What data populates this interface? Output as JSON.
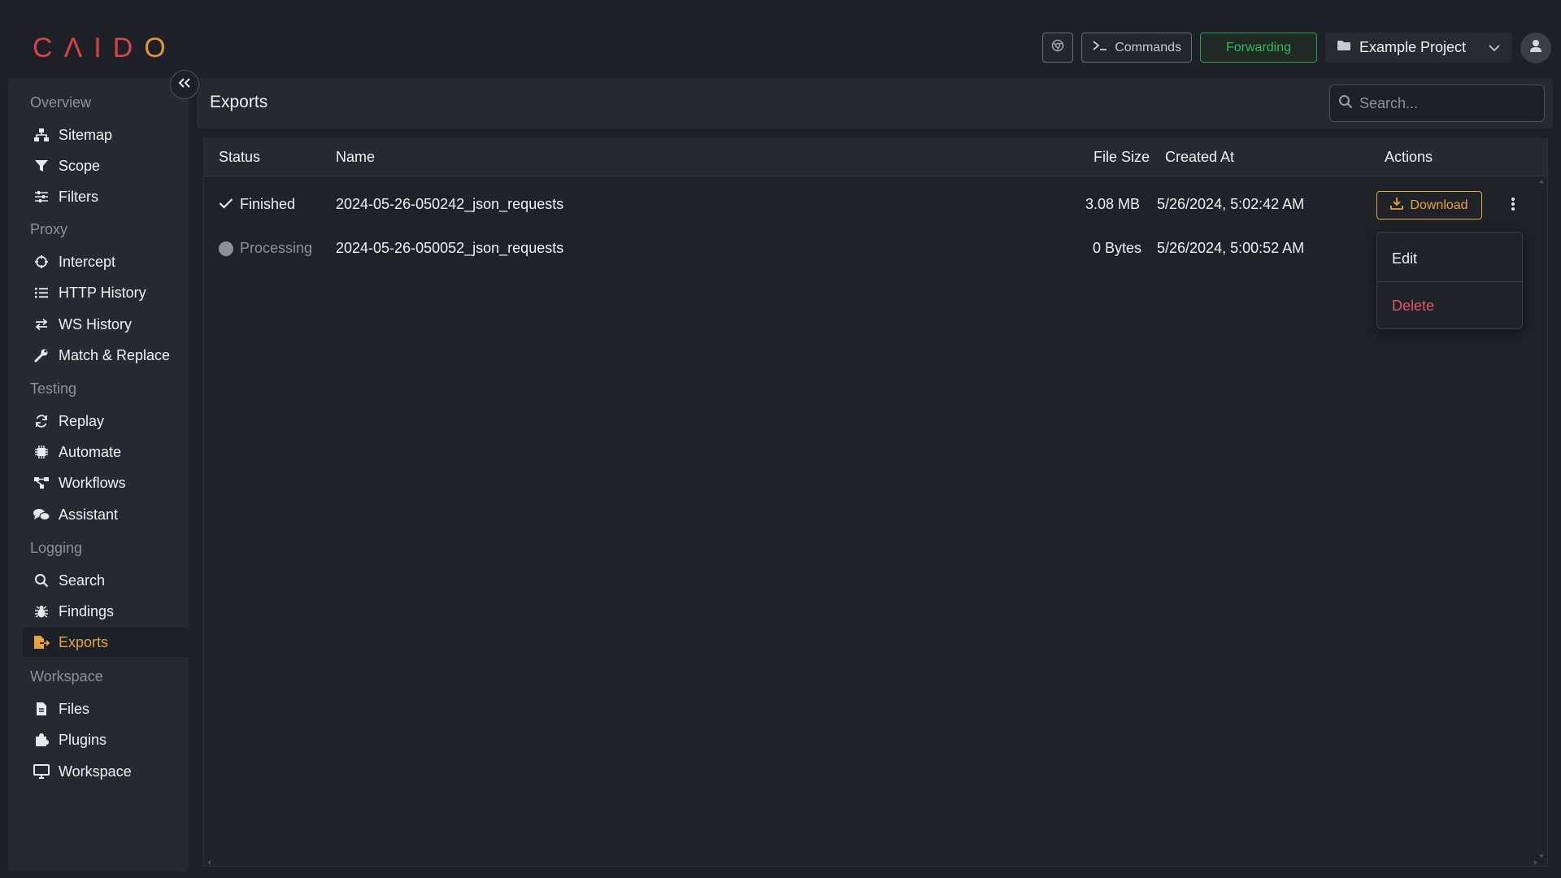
{
  "app": {
    "logo_letters": [
      "C",
      "Λ",
      "I",
      "D",
      "O"
    ]
  },
  "header": {
    "commands_label": "Commands",
    "forwarding_label": "Forwarding",
    "project_name": "Example Project"
  },
  "sidebar": {
    "sections": [
      {
        "label": "Overview",
        "items": [
          {
            "label": "Sitemap",
            "icon": "sitemap-icon"
          },
          {
            "label": "Scope",
            "icon": "funnel-icon"
          },
          {
            "label": "Filters",
            "icon": "sliders-icon"
          }
        ]
      },
      {
        "label": "Proxy",
        "items": [
          {
            "label": "Intercept",
            "icon": "crosshair-icon"
          },
          {
            "label": "HTTP History",
            "icon": "list-icon"
          },
          {
            "label": "WS History",
            "icon": "arrows-icon"
          },
          {
            "label": "Match & Replace",
            "icon": "wrench-icon"
          }
        ]
      },
      {
        "label": "Testing",
        "items": [
          {
            "label": "Replay",
            "icon": "rotate-icon"
          },
          {
            "label": "Automate",
            "icon": "chip-icon"
          },
          {
            "label": "Workflows",
            "icon": "workflow-icon"
          },
          {
            "label": "Assistant",
            "icon": "chat-icon"
          }
        ]
      },
      {
        "label": "Logging",
        "items": [
          {
            "label": "Search",
            "icon": "search-icon"
          },
          {
            "label": "Findings",
            "icon": "bug-icon"
          },
          {
            "label": "Exports",
            "icon": "export-icon"
          }
        ]
      },
      {
        "label": "Workspace",
        "items": [
          {
            "label": "Files",
            "icon": "file-icon"
          },
          {
            "label": "Plugins",
            "icon": "puzzle-icon"
          },
          {
            "label": "Workspace",
            "icon": "monitor-icon"
          }
        ]
      }
    ],
    "active_item": "Exports"
  },
  "main": {
    "title": "Exports",
    "search_placeholder": "Search...",
    "columns": {
      "status": "Status",
      "name": "Name",
      "file_size": "File Size",
      "created_at": "Created At",
      "actions": "Actions"
    },
    "rows": [
      {
        "status": "Finished",
        "name": "2024-05-26-050242_json_requests",
        "file_size": "3.08 MB",
        "created_at": "5/26/2024, 5:02:42 AM",
        "action": "Download"
      },
      {
        "status": "Processing",
        "name": "2024-05-26-050052_json_requests",
        "file_size": "0 Bytes",
        "created_at": "5/26/2024, 5:00:52 AM"
      }
    ],
    "context_menu": {
      "edit": "Edit",
      "delete": "Delete"
    }
  },
  "colors": {
    "background": "#1d2027",
    "panel": "#262930",
    "accent": "#e8a33c",
    "forwarding": "#34b85a",
    "logo_red": "#d8434a",
    "logo_orange": "#e2913e",
    "danger": "#e0566b"
  }
}
